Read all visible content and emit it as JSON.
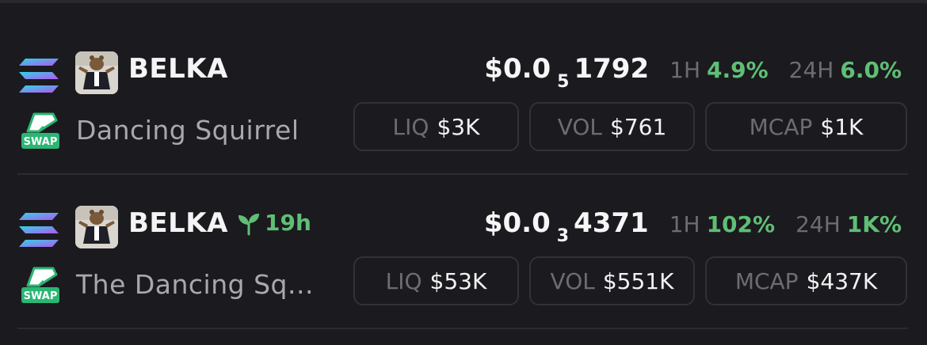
{
  "tokens": [
    {
      "chain_icon": "solana-icon",
      "dex_icon": "swap-eraser-icon",
      "dex_label": "SWAP",
      "symbol": "BELKA",
      "age": "",
      "name": "Dancing Squirrel",
      "price_prefix": "$0.0",
      "price_zeros": "5",
      "price_digits": "1792",
      "change_1h_label": "1H",
      "change_1h": "4.9%",
      "change_24h_label": "24H",
      "change_24h": "6.0%",
      "liq_label": "LIQ",
      "liq": "$3K",
      "vol_label": "VOL",
      "vol": "$761",
      "mcap_label": "MCAP",
      "mcap": "$1K"
    },
    {
      "chain_icon": "solana-icon",
      "dex_icon": "swap-eraser-icon",
      "dex_label": "SWAP",
      "symbol": "BELKA",
      "age_icon": "sprout-icon",
      "age": "19h",
      "name": "The Dancing Sq...",
      "price_prefix": "$0.0",
      "price_zeros": "3",
      "price_digits": "4371",
      "change_1h_label": "1H",
      "change_1h": "102%",
      "change_24h_label": "24H",
      "change_24h": "1K%",
      "liq_label": "LIQ",
      "liq": "$53K",
      "vol_label": "VOL",
      "vol": "$551K",
      "mcap_label": "MCAP",
      "mcap": "$437K"
    }
  ],
  "colors": {
    "background": "#1b1a1f",
    "positive": "#5fbf75",
    "muted": "#6d6c72",
    "border": "#323138"
  }
}
